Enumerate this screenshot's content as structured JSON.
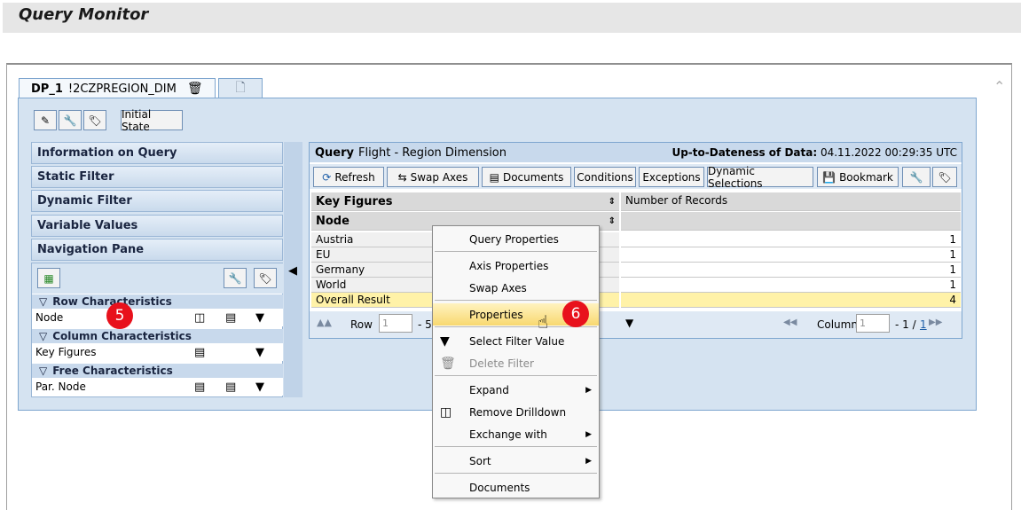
{
  "window": {
    "title": "Query Monitor"
  },
  "tabs": [
    {
      "label": "DP_1",
      "sublabel": "!2CZPREGION_DIM"
    }
  ],
  "toolbar": {
    "initial_state": "Initial State"
  },
  "nav": {
    "items": [
      "Information on Query",
      "Static Filter",
      "Dynamic Filter",
      "Variable Values",
      "Navigation Pane"
    ],
    "row_characteristics": "Row Characteristics",
    "row_items": [
      "Node"
    ],
    "column_characteristics": "Column Characteristics",
    "column_items": [
      "Key Figures"
    ],
    "free_characteristics": "Free Characteristics",
    "free_items": [
      "Par. Node"
    ]
  },
  "query": {
    "label": "Query",
    "name": "Flight - Region Dimension",
    "uptodate_label": "Up-to-Dateness of Data:",
    "uptodate_value": "04.11.2022 00:29:35 UTC",
    "buttons": [
      "Refresh",
      "Swap Axes",
      "Documents",
      "Conditions",
      "Exceptions",
      "Dynamic Selections",
      "Bookmark"
    ],
    "grid": {
      "key_figures_header": "Key Figures",
      "node_header": "Node",
      "measure_header": "Number of Records",
      "rows": [
        {
          "label": "Austria",
          "value": "1"
        },
        {
          "label": "EU",
          "value": "1"
        },
        {
          "label": "Germany",
          "value": "1"
        },
        {
          "label": "World",
          "value": "1"
        },
        {
          "label": "Overall Result",
          "value": "4"
        }
      ]
    },
    "pager": {
      "row_label": "Row",
      "row_value": "1",
      "row_suffix": "- 5",
      "column_label": "Column",
      "column_value": "1",
      "column_prefix": "- 1 /",
      "column_total": "1"
    }
  },
  "context_menu": {
    "items": [
      "Query Properties",
      "Axis Properties",
      "Swap Axes",
      "Properties",
      "Select Filter Value",
      "Delete Filter",
      "Expand",
      "Remove Drilldown",
      "Exchange with",
      "Sort",
      "Documents"
    ]
  },
  "badges": {
    "step5": "5",
    "step6": "6"
  },
  "colors": {
    "accent": "#7ea6cf",
    "highlight": "#fff2a8",
    "badge": "#e8111c"
  }
}
